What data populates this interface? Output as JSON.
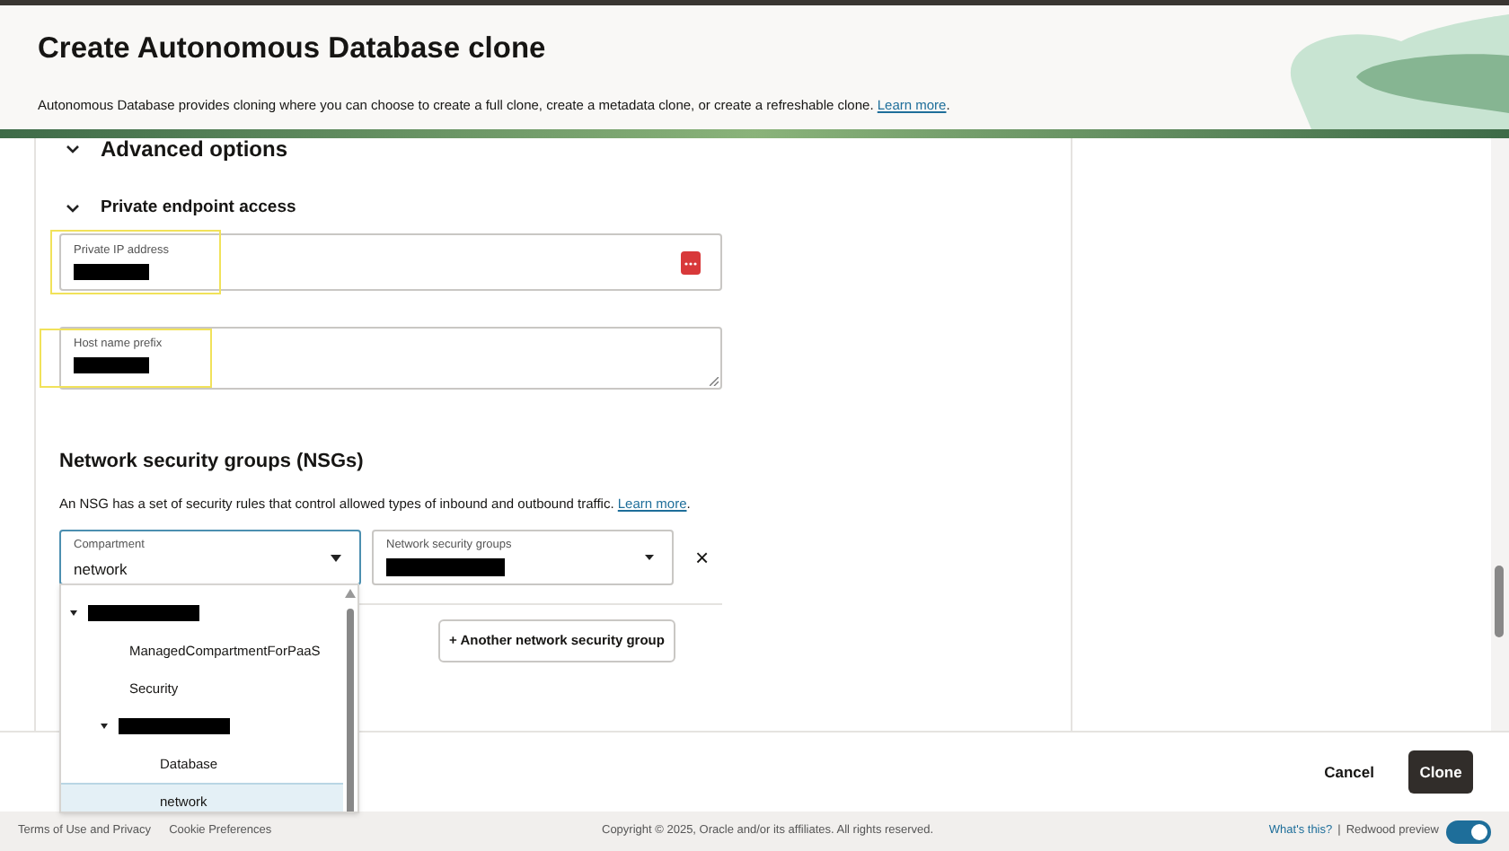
{
  "header": {
    "title": "Create Autonomous Database clone",
    "description": "Autonomous Database provides cloning where you can choose to create a full clone, create a metadata clone, or create a refreshable clone.",
    "learn_more": "Learn more",
    "period": "."
  },
  "sections": [
    {
      "title": "Advanced options",
      "expanded": true
    },
    {
      "title": "Private endpoint access",
      "expanded": true
    }
  ],
  "fields": [
    {
      "kind": "input",
      "label": "Private IP address"
    },
    {
      "kind": "textarea",
      "label": "Host name prefix"
    }
  ],
  "nsg": {
    "title": "Network security groups (NSGs)",
    "description": "An NSG has a set of security rules that control allowed types of inbound and outbound traffic.",
    "learn_more": "Learn more",
    "period": ".",
    "compartment": {
      "label": "Compartment",
      "value": "network"
    },
    "groups": {
      "label": "Network security groups"
    },
    "remove": "×",
    "add_button": "+ Another network security group"
  },
  "tree": [
    {
      "kind": "redacted",
      "expanded": true,
      "selected": false,
      "children": [
        {
          "kind": "text",
          "label": "ManagedCompartmentForPaaS",
          "selected": false
        },
        {
          "kind": "text",
          "label": "Security",
          "selected": false
        },
        {
          "kind": "redacted",
          "expanded": true,
          "selected": false,
          "children": [
            {
              "kind": "text",
              "label": "Database",
              "selected": false
            },
            {
              "kind": "text",
              "label": "network",
              "selected": true
            }
          ]
        }
      ]
    }
  ],
  "actions": {
    "cancel": "Cancel",
    "clone": "Clone"
  },
  "footer": {
    "links": [
      "Terms of Use and Privacy",
      "Cookie Preferences"
    ],
    "copyright": "Copyright © 2025, Oracle and/or its affiliates. All rights reserved.",
    "whats_this": "What's this?",
    "separator": "|",
    "preview_label": "Redwood preview",
    "preview_on": true
  }
}
